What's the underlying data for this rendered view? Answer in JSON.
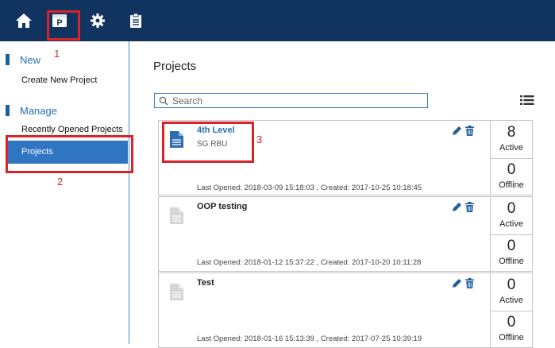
{
  "colors": {
    "topbar": "#10345f",
    "accent": "#2f75c2",
    "annotation": "#d8232a"
  },
  "topbar": {
    "icons": [
      {
        "name": "home-icon"
      },
      {
        "name": "projects-icon",
        "glyph": "P"
      },
      {
        "name": "gear-icon"
      },
      {
        "name": "clipboard-icon"
      }
    ]
  },
  "sidebar": {
    "sections": [
      {
        "label": "New",
        "items": [
          "Create New Project"
        ]
      },
      {
        "label": "Manage",
        "items": [
          "Recently Opened Projects",
          "Projects"
        ]
      }
    ],
    "active_item": "Projects"
  },
  "annotations": {
    "n1": "1",
    "n2": "2",
    "n3": "3"
  },
  "main": {
    "title": "Projects",
    "search_placeholder": "Search",
    "projects": [
      {
        "name": "4th Level",
        "subtitle": "SG RBU",
        "meta": "Last Opened: 2018-03-09 15:18:03 , Created: 2017-10-25 10:18:45",
        "active": "8",
        "active_label": "Active",
        "offline": "0",
        "offline_label": "Offline",
        "highlighted": true
      },
      {
        "name": "OOP testing",
        "subtitle": "",
        "meta": "Last Opened: 2018-01-12 15:37:22 , Created: 2017-10-20 10:11:28",
        "active": "0",
        "active_label": "Active",
        "offline": "0",
        "offline_label": "Offline",
        "highlighted": false
      },
      {
        "name": "Test",
        "subtitle": "",
        "meta": "Last Opened: 2018-01-16 15:13:39 , Created: 2017-07-25 10:39:19",
        "active": "0",
        "active_label": "Active",
        "offline": "0",
        "offline_label": "Offline",
        "highlighted": false
      }
    ]
  }
}
